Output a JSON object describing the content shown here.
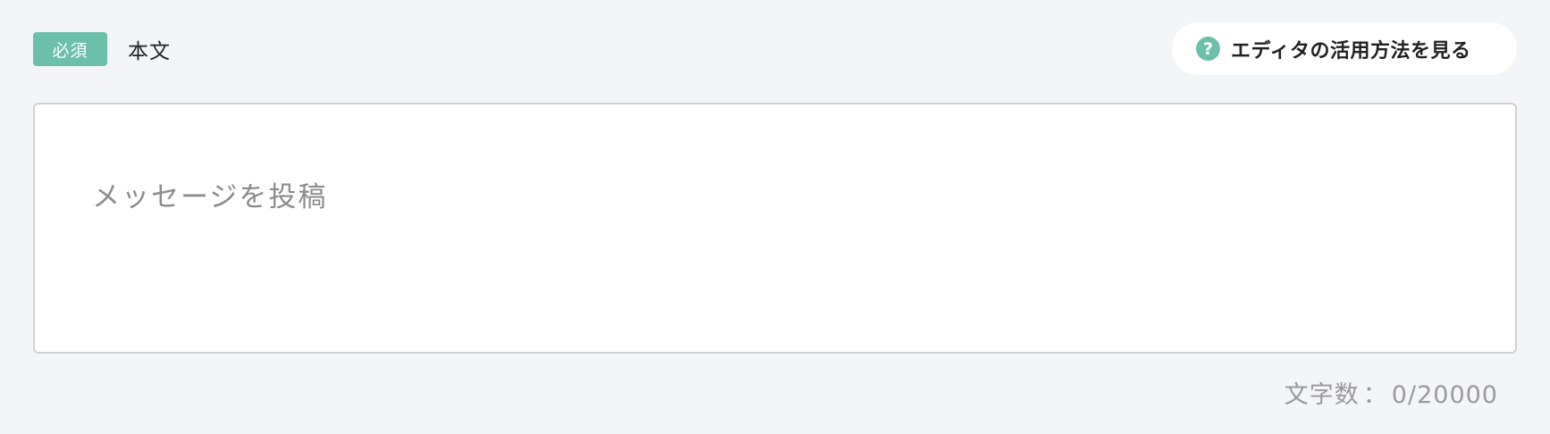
{
  "field": {
    "required_badge": "必須",
    "label": "本文"
  },
  "help": {
    "icon": "question-circle-icon",
    "icon_glyph": "?",
    "label": "エディタの活用方法を見る"
  },
  "editor": {
    "placeholder": "メッセージを投稿",
    "value": ""
  },
  "counter": {
    "label": "文字数",
    "separator": "：",
    "current": "0",
    "max": "20000"
  },
  "colors": {
    "accent": "#6cc0aa",
    "background": "#f4f5f8",
    "editor_border": "#cfd1d4"
  }
}
